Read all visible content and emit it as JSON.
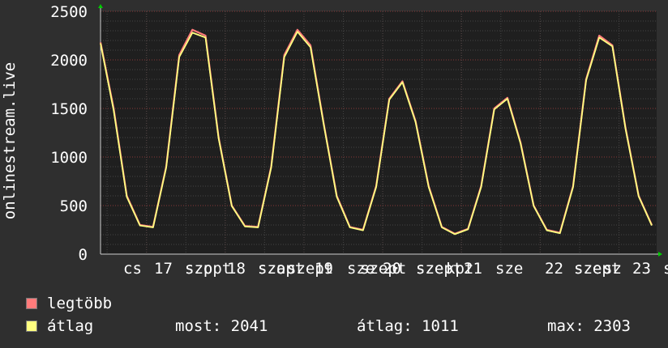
{
  "chart_data": {
    "type": "line",
    "ylabel": "onlinestream.live",
    "yticks": [
      "0",
      "500",
      "1000",
      "1500",
      "2000",
      "2500"
    ],
    "ylim": [
      0,
      2500
    ],
    "grid": true,
    "x_tick_labels": [
      "cs",
      "17",
      "szo",
      "18",
      "szo",
      "19",
      "sze",
      "20",
      "sze",
      "21",
      "sze",
      "22",
      "sze",
      "23",
      "s"
    ],
    "x_overlap_labels": [
      "szppt",
      "szapt",
      "szept",
      "szept",
      "szept",
      "kpt",
      "szept",
      "sz"
    ],
    "x": [
      0,
      4,
      8,
      12,
      16,
      20,
      24,
      28,
      32,
      36,
      40,
      44,
      48,
      52,
      56,
      60,
      64,
      68,
      72,
      76,
      80,
      84,
      88,
      92,
      96,
      100,
      104,
      108,
      112,
      116,
      120,
      124,
      128,
      132,
      136,
      140,
      144,
      148,
      152,
      156,
      160,
      164,
      168
    ],
    "series": [
      {
        "name": "legtöbb",
        "color": "#ff7b7b",
        "values": [
          2180,
          1500,
          600,
          300,
          280,
          900,
          2050,
          2310,
          2250,
          1200,
          500,
          290,
          280,
          900,
          2050,
          2310,
          2150,
          1350,
          600,
          280,
          250,
          700,
          1600,
          1780,
          1370,
          700,
          280,
          210,
          260,
          700,
          1500,
          1610,
          1150,
          500,
          250,
          220,
          700,
          1800,
          2250,
          2150,
          1300,
          600,
          300
        ]
      },
      {
        "name": "átlag",
        "color": "#ffff80",
        "values": [
          2170,
          1480,
          590,
          295,
          275,
          890,
          2030,
          2280,
          2230,
          1190,
          495,
          285,
          275,
          890,
          2030,
          2290,
          2130,
          1340,
          590,
          275,
          245,
          690,
          1590,
          1770,
          1360,
          690,
          275,
          205,
          255,
          690,
          1490,
          1600,
          1140,
          495,
          245,
          215,
          690,
          1790,
          2230,
          2140,
          1290,
          595,
          295
        ]
      }
    ]
  },
  "legend": {
    "max_label": "legtöbb",
    "avg_label": "átlag",
    "max_color": "#ff7b7b",
    "avg_color": "#ffff80",
    "now_text": "most: 2041",
    "avg_text": "átlag: 1011",
    "peak_text": "max: 2303"
  }
}
